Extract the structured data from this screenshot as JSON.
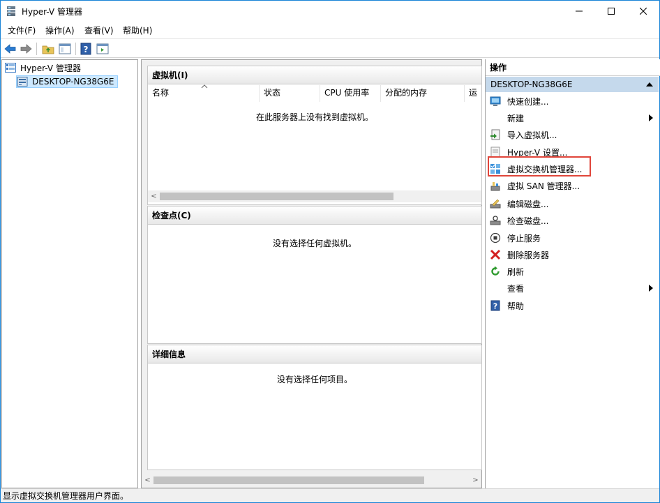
{
  "window": {
    "title": "Hyper-V 管理器"
  },
  "menu": [
    "文件(F)",
    "操作(A)",
    "查看(V)",
    "帮助(H)"
  ],
  "tree": {
    "root": "Hyper-V 管理器",
    "server": "DESKTOP-NG38G6E"
  },
  "vm_section": {
    "title": "虚拟机(I)",
    "columns": [
      "名称",
      "状态",
      "CPU 使用率",
      "分配的内存",
      "运行"
    ],
    "empty_message": "在此服务器上没有找到虚拟机。"
  },
  "checkpoint_section": {
    "title": "检查点(C)",
    "empty_message": "没有选择任何虚拟机。"
  },
  "details_section": {
    "title": "详细信息",
    "empty_message": "没有选择任何项目。"
  },
  "actions": {
    "header": "操作",
    "group": "DESKTOP-NG38G6E",
    "items": [
      {
        "label": "快速创建...",
        "icon": "quick-create-icon"
      },
      {
        "label": "新建",
        "icon": "none",
        "submenu": true
      },
      {
        "label": "导入虚拟机...",
        "icon": "import-vm-icon"
      },
      {
        "label": "Hyper-V 设置...",
        "icon": "settings-icon"
      },
      {
        "label": "虚拟交换机管理器...",
        "icon": "virtual-switch-icon"
      },
      {
        "label": "虚拟 SAN 管理器...",
        "icon": "san-icon"
      },
      {
        "label": "编辑磁盘...",
        "icon": "edit-disk-icon"
      },
      {
        "label": "检查磁盘...",
        "icon": "inspect-disk-icon"
      },
      {
        "label": "停止服务",
        "icon": "stop-icon"
      },
      {
        "label": "删除服务器",
        "icon": "delete-icon"
      },
      {
        "label": "刷新",
        "icon": "refresh-icon"
      },
      {
        "label": "查看",
        "icon": "none",
        "submenu": true
      },
      {
        "label": "帮助",
        "icon": "help-icon"
      }
    ]
  },
  "status_bar": "显示虚拟交换机管理器用户界面。",
  "colors": {
    "window_border": "#1883d7",
    "group_bg": "#c5d9ec",
    "selection_bg": "#cce8ff",
    "highlight": "#e0453a"
  }
}
